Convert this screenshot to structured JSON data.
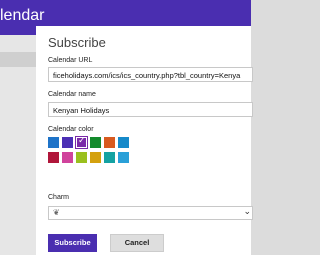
{
  "app": {
    "title": "lendar"
  },
  "subscribe": {
    "title": "Subscribe",
    "calendar_url": {
      "label": "Calendar URL",
      "value": "ficeholidays.com/ics/ics_country.php?tbl_country=Kenya"
    },
    "calendar_name": {
      "label": "Calendar name",
      "value": "Kenyan Holidays"
    },
    "calendar_color": {
      "label": "Calendar color",
      "selected_index": 2,
      "swatches": [
        "#1e73c8",
        "#4b2fb4",
        "#7a29a8",
        "#138a2c",
        "#d85a1f",
        "#1689c9",
        "#b0163a",
        "#d0439c",
        "#9ac01e",
        "#d4a10e",
        "#14a2a2",
        "#2aa0d8"
      ]
    },
    "charm": {
      "label": "Charm",
      "icon": "paw-icon"
    },
    "buttons": {
      "subscribe": "Subscribe",
      "cancel": "Cancel"
    }
  }
}
